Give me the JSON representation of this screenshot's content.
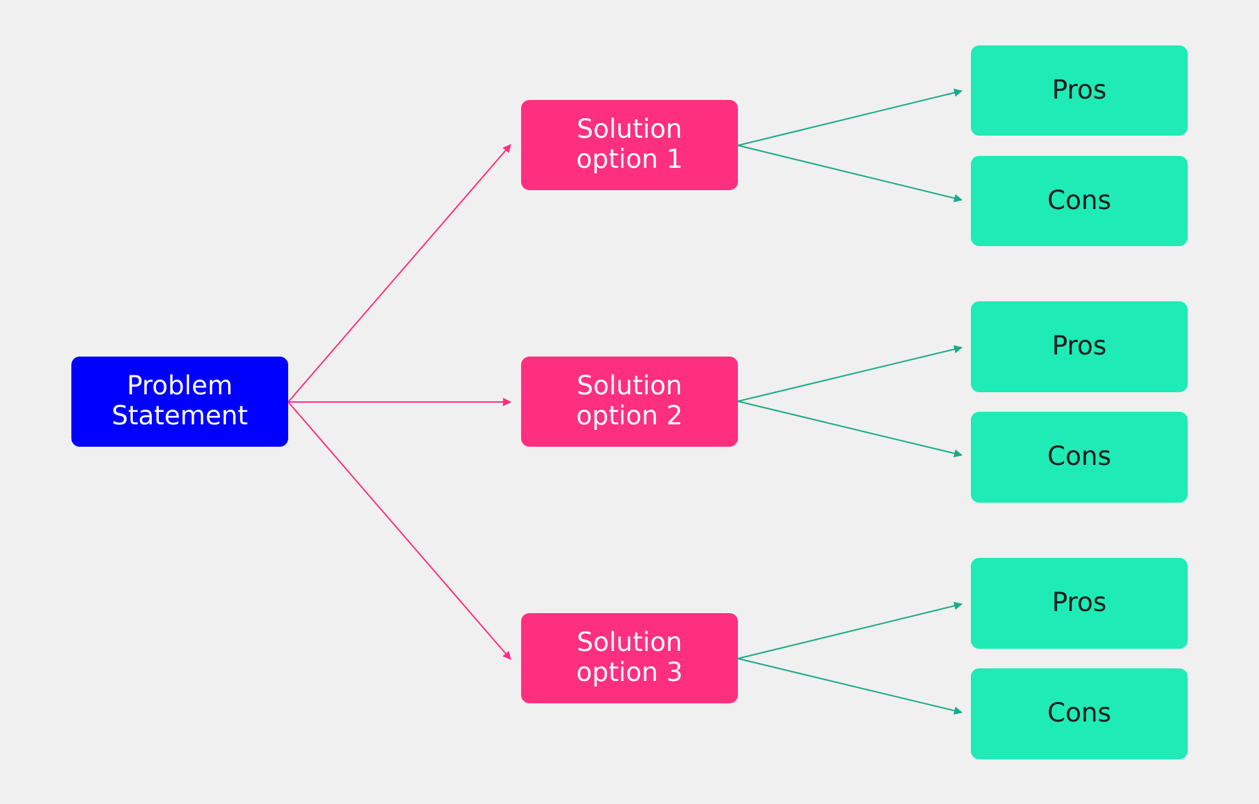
{
  "diagram": {
    "title": "",
    "colors": {
      "background": "#f0f0f0",
      "problem": "#0000ff",
      "solution": "#ff2f80",
      "outcome": "#1eebb6",
      "problem_links": "#ff2f80",
      "outcome_links": "#1aaa88",
      "light_text": "#ffffff",
      "dark_text": "#1a1a1a"
    },
    "problem": {
      "lines": [
        "Problem",
        "Statement"
      ]
    },
    "solutions": [
      {
        "lines": [
          "Solution",
          "option 1"
        ],
        "pros": "Pros",
        "cons": "Cons"
      },
      {
        "lines": [
          "Solution",
          "option 2"
        ],
        "pros": "Pros",
        "cons": "Cons"
      },
      {
        "lines": [
          "Solution",
          "option 3"
        ],
        "pros": "Pros",
        "cons": "Cons"
      }
    ],
    "edges": [
      {
        "from": "Problem Statement",
        "to": "Solution option 1"
      },
      {
        "from": "Problem Statement",
        "to": "Solution option 2"
      },
      {
        "from": "Problem Statement",
        "to": "Solution option 3"
      },
      {
        "from": "Solution option 1",
        "to": "Pros"
      },
      {
        "from": "Solution option 1",
        "to": "Cons"
      },
      {
        "from": "Solution option 2",
        "to": "Pros"
      },
      {
        "from": "Solution option 2",
        "to": "Cons"
      },
      {
        "from": "Solution option 3",
        "to": "Pros"
      },
      {
        "from": "Solution option 3",
        "to": "Cons"
      }
    ]
  }
}
